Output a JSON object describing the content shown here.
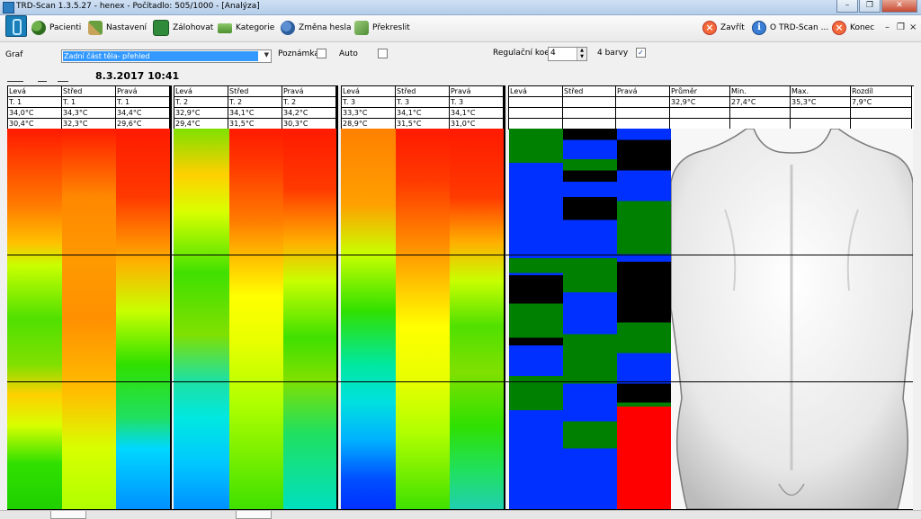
{
  "window": {
    "title": "TRD-Scan 1.3.5.27  - henex - Počítadlo: 505/1000 - [Analýza]"
  },
  "toolbar": {
    "patients": "Pacienti",
    "settings": "Nastavení",
    "backup": "Zálohovat",
    "categories": "Kategorie",
    "change_password": "Změna hesla",
    "redraw": "Překreslit",
    "close": "Zavřít",
    "about": "O TRD-Scan ...",
    "exit": "Konec"
  },
  "form": {
    "graph_label": "Graf",
    "graph_value": "Zadní část těla- přehled",
    "note_label": "Poznámka",
    "note_checked": false,
    "auto_label": "Auto",
    "auto_checked": false,
    "regulation_label": "Regulační koef.",
    "regulation_value": "4",
    "four_colors_label": "4 barvy",
    "four_colors_checked": true
  },
  "datetime": "8.3.2017 10:41",
  "groups": [
    {
      "cols": [
        {
          "h": "Levá",
          "t": "T. 1",
          "v1": "34,0°C",
          "v2": "30,4°C"
        },
        {
          "h": "Střed",
          "t": "T. 1",
          "v1": "34,3°C",
          "v2": "32,3°C"
        },
        {
          "h": "Pravá",
          "t": "T. 1",
          "v1": "34,4°C",
          "v2": "29,6°C"
        }
      ]
    },
    {
      "cols": [
        {
          "h": "Levá",
          "t": "T. 2",
          "v1": "32,9°C",
          "v2": "29,4°C"
        },
        {
          "h": "Střed",
          "t": "T. 2",
          "v1": "34,1°C",
          "v2": "31,5°C"
        },
        {
          "h": "Pravá",
          "t": "T. 2",
          "v1": "34,2°C",
          "v2": "30,3°C"
        }
      ]
    },
    {
      "cols": [
        {
          "h": "Levá",
          "t": "T. 3",
          "v1": "33,3°C",
          "v2": "28,9°C"
        },
        {
          "h": "Střed",
          "t": "T. 3",
          "v1": "34,1°C",
          "v2": "31,5°C"
        },
        {
          "h": "Pravá",
          "t": "T. 3",
          "v1": "34,1°C",
          "v2": "31,0°C"
        }
      ]
    }
  ],
  "summary": {
    "cols": [
      "Levá",
      "Střed",
      "Pravá"
    ],
    "stats_headers": [
      "Průměr",
      "Min.",
      "Max.",
      "Rozdíl"
    ],
    "stats_values": [
      "32,9°C",
      "27,4°C",
      "35,3°C",
      "7,9°C"
    ]
  },
  "colors": {
    "red": "#ff0000",
    "orange": "#ff8000",
    "yellow": "#ffff00",
    "green": "#00c000",
    "cyan": "#00ffd0",
    "blue": "#0030ff",
    "dark_green": "#008000",
    "black": "#000000"
  }
}
